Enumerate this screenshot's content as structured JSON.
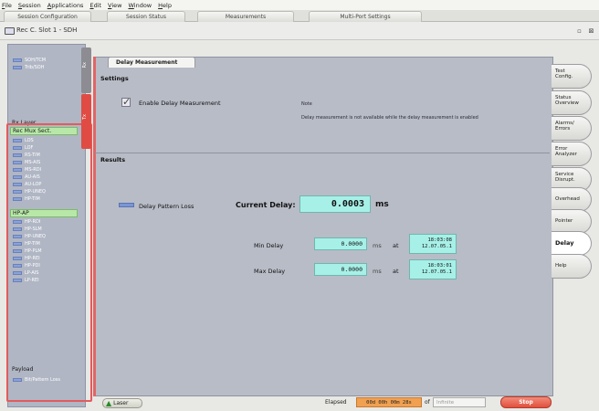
{
  "menu": [
    {
      "u": "F",
      "rest": "ile"
    },
    {
      "u": "S",
      "rest": "ession"
    },
    {
      "u": "A",
      "rest": "pplications"
    },
    {
      "u": "E",
      "rest": "dit"
    },
    {
      "u": "V",
      "rest": "iew"
    },
    {
      "u": "W",
      "rest": "indow"
    },
    {
      "u": "H",
      "rest": "elp"
    }
  ],
  "top_tabs": [
    "Session Configuration",
    "Session Status",
    "Measurements",
    "Multi-Port Settings"
  ],
  "window_title": "Rec C. Slot 1 - SDH",
  "window_buttons": {
    "restore": "▫",
    "close": "⊠"
  },
  "sidebar": {
    "top_items": [
      "SOH/TCM",
      "Trib/SOH"
    ],
    "section_label": "Rx Layer",
    "group1": "Rec Mux Sect.",
    "group1_items": [
      "LOS",
      "LOF",
      "RS-TIM",
      "MS-AIS",
      "MS-RDI",
      "AU-AIS",
      "AU-LOP",
      "HP-UNEQ",
      "HP-TIM"
    ],
    "group2": "HP-AP",
    "group2_items": [
      "HP-RDI",
      "HP-SLM",
      "HP-UNEQ",
      "HP-TIM",
      "HP-PLM",
      "HP-REI",
      "HP-PDI",
      "LP-AIS",
      "LP-REI"
    ],
    "payload_label": "Payload",
    "payload_item": "Bit/Pattern Loss",
    "vtab_top": "Rx",
    "vtab_red": "Tx"
  },
  "tab_label": "Delay Measurement",
  "settings": {
    "title": "Settings",
    "enable_label": "Enable Delay Measurement",
    "note_title": "Note",
    "note_text": "Delay measurement is not available while the delay measurement is enabled"
  },
  "results": {
    "title": "Results",
    "legend_label": "Delay Pattern Loss",
    "current_label": "Current Delay:",
    "current_value": "0.0003",
    "current_unit": "ms",
    "min_label": "Min Delay",
    "min_value": "0.0000",
    "max_label": "Max Delay",
    "max_value": "0.0000",
    "row_unit": "ms",
    "at_label": "at",
    "min_time": "18:03:08",
    "min_date": "12.07.05.1",
    "max_time": "18:03:01",
    "max_date": "12.07.05.1"
  },
  "right_nav": [
    {
      "line1": "Test",
      "line2": "Config."
    },
    {
      "line1": "Status",
      "line2": "Overview"
    },
    {
      "line1": "Alarms/",
      "line2": "Errors"
    },
    {
      "line1": "Error",
      "line2": "Analyzer"
    },
    {
      "line1": "Service",
      "line2": "Disrupt."
    },
    {
      "line1": "Overhead",
      "line2": ""
    },
    {
      "line1": "Pointer",
      "line2": ""
    },
    {
      "line1": "Delay",
      "line2": ""
    },
    {
      "line1": "Help",
      "line2": ""
    }
  ],
  "active_nav_index": 7,
  "status": {
    "warn_label": "Laser",
    "elapsed_label": "Elapsed",
    "elapsed_value": "00d 00h 00m 28s",
    "of_label": "of",
    "of_placeholder": "Infinite",
    "stop_label": "Stop"
  },
  "colors": {
    "value_box": "#a7f0e8",
    "active_group": "#b8e8a8",
    "elapsed": "#f0a050",
    "stop": "#e0503c",
    "accent_red": "#e06666",
    "sidebar_blue": "#8aa2d8"
  }
}
